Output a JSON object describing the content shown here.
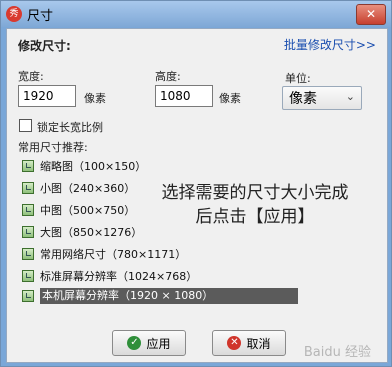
{
  "window": {
    "icon_text": "秀",
    "title": "尺寸",
    "close_label": "✕"
  },
  "resize": {
    "section_title": "修改尺寸:",
    "batch_link": "批量修改尺寸>>"
  },
  "width": {
    "label": "宽度:",
    "value": "1920",
    "unit": "像素"
  },
  "height": {
    "label": "高度:",
    "value": "1080",
    "unit": "像素"
  },
  "unit": {
    "label": "单位:",
    "value": "像素"
  },
  "lock_ratio": {
    "label": "锁定长宽比例",
    "checked": false
  },
  "presets": {
    "title": "常用尺寸推荐:",
    "items": [
      "缩略图（100×150）",
      "小图（240×360）",
      "中图（500×750）",
      "大图（850×1276）",
      "常用网络尺寸（780×1171）",
      "标准屏幕分辨率（1024×768）",
      "本机屏幕分辨率（1920 × 1080）"
    ],
    "selected_index": 6
  },
  "overlay": {
    "line1": "选择需要的尺寸大小完成",
    "line2": "后点击【应用】"
  },
  "buttons": {
    "apply": "应用",
    "cancel": "取消"
  },
  "watermark": "Baidu 经验"
}
